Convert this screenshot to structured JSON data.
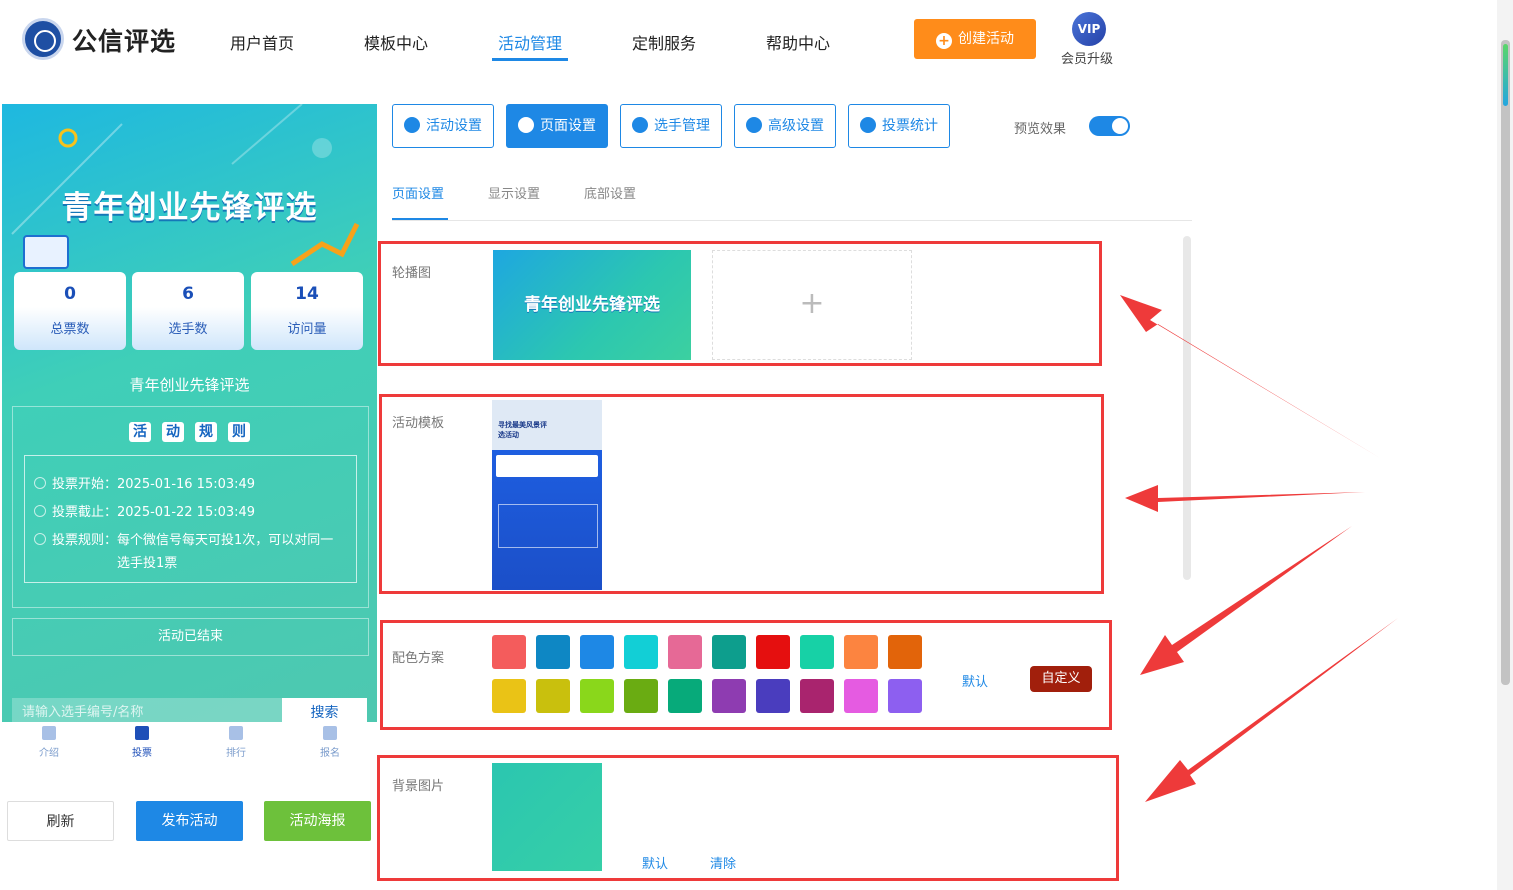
{
  "brand": {
    "name": "公信评选"
  },
  "nav": {
    "items": [
      {
        "label": "用户首页"
      },
      {
        "label": "模板中心"
      },
      {
        "label": "活动管理"
      },
      {
        "label": "定制服务"
      },
      {
        "label": "帮助中心"
      }
    ],
    "active": "活动管理"
  },
  "header": {
    "create_label": "创建活动",
    "vip_badge": "VIP",
    "vip_label": "会员升级"
  },
  "preview": {
    "title": "青年创业先锋评选",
    "stats": [
      {
        "value": "0",
        "label": "总票数"
      },
      {
        "value": "6",
        "label": "选手数"
      },
      {
        "value": "14",
        "label": "访问量"
      }
    ],
    "subtitle": "青年创业先锋评选",
    "rules_chips": [
      "活",
      "动",
      "规",
      "则"
    ],
    "rules": {
      "start": "投票开始：2025-01-16 15:03:49",
      "end": "投票截止：2025-01-22 15:03:49",
      "rule1": "投票规则：每个微信号每天可投1次，可以对同一",
      "rule2": "选手投1票"
    },
    "status": "活动已结束",
    "search_placeholder": "请输入选手编号/名称",
    "search_button": "搜索",
    "tabbar": [
      {
        "label": "介绍"
      },
      {
        "label": "投票"
      },
      {
        "label": "排行"
      },
      {
        "label": "报名"
      }
    ],
    "active_tab": "投票"
  },
  "bottom_buttons": {
    "refresh": "刷新",
    "publish": "发布活动",
    "poster": "活动海报"
  },
  "toolbar": {
    "buttons": [
      "活动设置",
      "页面设置",
      "选手管理",
      "高级设置",
      "投票统计"
    ],
    "active": "页面设置",
    "preview_label": "预览效果",
    "preview_on": true
  },
  "subtabs": {
    "items": [
      "页面设置",
      "显示设置",
      "底部设置"
    ],
    "active": "页面设置"
  },
  "sections": {
    "carousel": {
      "label": "轮播图",
      "image_title": "青年创业先锋评选",
      "add_icon": "+"
    },
    "template": {
      "label": "活动模板",
      "thumb_title": "寻找最美风景评选活动"
    },
    "color": {
      "label": "配色方案",
      "default": "默认",
      "custom": "自定义",
      "swatches_row1": [
        "#f45c5c",
        "#0e87c4",
        "#1e88e5",
        "#12cfd6",
        "#e66996",
        "#0d9e8d",
        "#e50f0f",
        "#17d1a6",
        "#fc8440",
        "#e2640a"
      ],
      "swatches_row2": [
        "#eac316",
        "#c9c00d",
        "#8ad71b",
        "#6aac12",
        "#07aa7a",
        "#8e3cb1",
        "#4a3dbe",
        "#a9246e",
        "#e55be1",
        "#8d5ff0"
      ]
    },
    "background": {
      "label": "背景图片",
      "default": "默认",
      "clear": "清除"
    }
  },
  "colors": {
    "accent": "#1e88e5",
    "orange": "#ff8c1a",
    "annotation_red": "#ee3a3a",
    "custom_button": "#a11f0c"
  }
}
